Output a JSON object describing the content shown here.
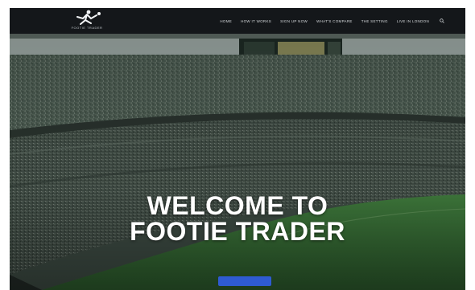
{
  "brand": {
    "logo_icon": "footballer-kick-icon",
    "logo_text": "FOOTIE TRADER"
  },
  "nav": {
    "items": [
      {
        "label": "HOME"
      },
      {
        "label": "HOW IT WORKS"
      },
      {
        "label": "SIGN UP NOW"
      },
      {
        "label": "WHAT'S COMPARE"
      },
      {
        "label": "THE SETTING"
      },
      {
        "label": "LIVE IN LONDON"
      }
    ],
    "search_icon": "search-icon"
  },
  "hero": {
    "title_line1": "WELCOME TO",
    "title_line2": "FOOTIE TRADER",
    "subtitle": "",
    "cta_label": "",
    "background": "stadium-crowd-photo"
  },
  "colors": {
    "nav_background": "#14171a",
    "cta_background": "#2f5bd2",
    "title_color": "#ffffff"
  }
}
